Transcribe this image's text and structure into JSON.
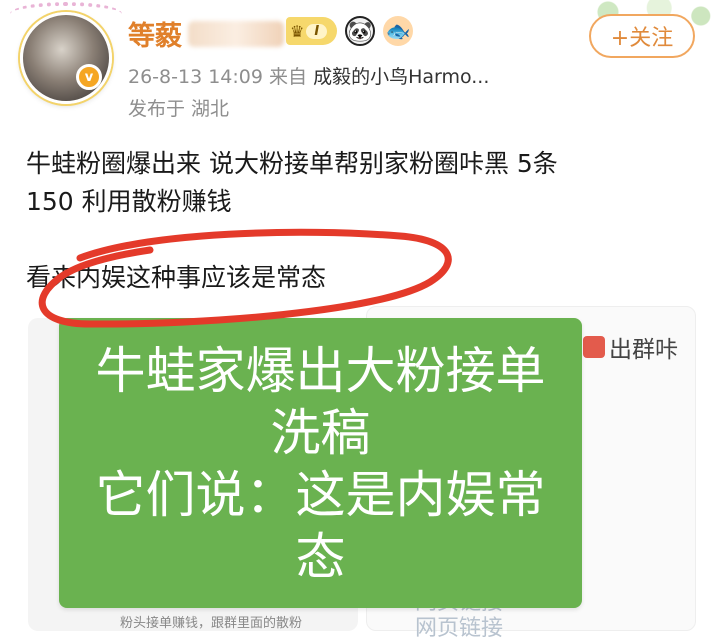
{
  "post": {
    "username": "等藙",
    "level": "I",
    "follow_label": "+关注",
    "timestamp": "26-8-13 14:09",
    "source_prefix": "来自",
    "source": "成毅的小鸟Harmo...",
    "location": "发布于 湖北",
    "verified_mark": "v",
    "content": {
      "line1": "牛蛙粉圈爆出来  说大粉接单帮别家粉圈咔黑   5条",
      "line2": "150  利用散粉赚钱",
      "line3": "看来内娱这种事应该是常态"
    }
  },
  "image_right": {
    "label": "出群咔",
    "link1": "网页链接",
    "link2": "网页链接"
  },
  "image_left": {
    "caption": "粉头接单赚钱，跟群里面的散粉"
  },
  "overlay": {
    "line1": "牛蛙家爆出大粉接单",
    "line2": "洗稿",
    "line3": "它们说：这是内娱常",
    "line4": "态"
  },
  "icons": {
    "crown": "crown-icon",
    "panda": "panda-icon",
    "fish": "fish-icon",
    "verified": "verified-icon"
  },
  "colors": {
    "username": "#e0802b",
    "follow": "#e08a3b",
    "overlay_bg": "#6ab250",
    "circle": "#e43a2a"
  }
}
